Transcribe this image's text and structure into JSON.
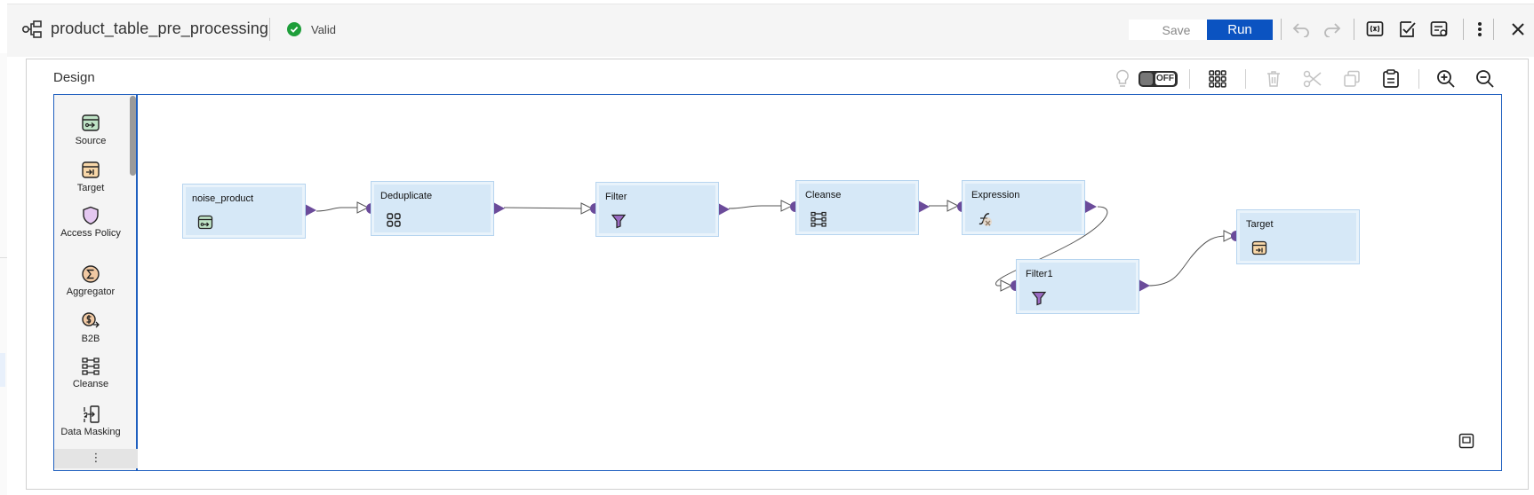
{
  "header": {
    "title": "product_table_pre_processing",
    "status": "Valid",
    "save_label": "Save",
    "run_label": "Run",
    "accent_color": "#0b53c1",
    "status_color": "#1e9e3a",
    "tools": [
      "undo-icon",
      "redo-icon",
      "parameters-icon",
      "validate-icon",
      "properties-icon",
      "more-vertical-icon",
      "close-icon"
    ]
  },
  "design": {
    "label": "Design",
    "toggle_label": "OFF",
    "tools": [
      "lightbulb-icon",
      "arrange-grid-icon",
      "delete-icon",
      "cut-icon",
      "copy-icon",
      "paste-icon",
      "zoom-in-icon",
      "zoom-out-icon",
      "fit-to-screen-icon"
    ]
  },
  "palette": {
    "items": [
      {
        "label": "Source",
        "icon": "source-icon"
      },
      {
        "label": "Target",
        "icon": "target-icon"
      },
      {
        "label": "Access Policy",
        "icon": "access-policy-icon"
      },
      {
        "label": "Aggregator",
        "icon": "aggregator-icon"
      },
      {
        "label": "B2B",
        "icon": "b2b-icon"
      },
      {
        "label": "Cleanse",
        "icon": "cleanse-icon"
      },
      {
        "label": "Data Masking",
        "icon": "data-masking-icon"
      }
    ],
    "more_label": "⋮"
  },
  "canvas": {
    "node_color": "#d6e8f7",
    "port_color": "#6b4b9a",
    "nodes": [
      {
        "label": "noise_product",
        "icon": "source-icon"
      },
      {
        "label": "Deduplicate",
        "icon": "deduplicate-icon"
      },
      {
        "label": "Filter",
        "icon": "filter-icon"
      },
      {
        "label": "Cleanse",
        "icon": "cleanse-icon"
      },
      {
        "label": "Expression",
        "icon": "expression-icon"
      },
      {
        "label": "Filter1",
        "icon": "filter-icon"
      },
      {
        "label": "Target",
        "icon": "target-icon"
      }
    ]
  }
}
